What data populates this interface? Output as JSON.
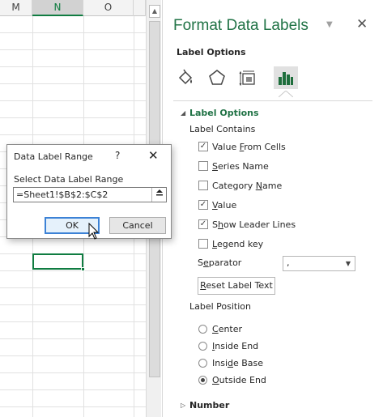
{
  "sheet": {
    "columns": [
      "M",
      "N",
      "O"
    ],
    "selected_column": "N"
  },
  "pane": {
    "title": "Format Data Labels",
    "subtitle": "Label Options",
    "tabs": [
      {
        "icon": "paint-bucket-icon"
      },
      {
        "icon": "pentagon-icon"
      },
      {
        "icon": "size-properties-icon"
      },
      {
        "icon": "bar-chart-icon",
        "active": true
      }
    ],
    "label_options_header": "Label Options",
    "label_contains": "Label Contains",
    "checkboxes": [
      {
        "pre": "Value ",
        "key": "F",
        "post": "rom Cells",
        "checked": true
      },
      {
        "pre": "",
        "key": "S",
        "post": "eries Name",
        "checked": false
      },
      {
        "pre": "Category ",
        "key": "N",
        "post": "ame",
        "checked": false
      },
      {
        "pre": "",
        "key": "V",
        "post": "alue",
        "checked": true
      },
      {
        "pre": "S",
        "key": "h",
        "post": "ow Leader Lines",
        "checked": true
      },
      {
        "pre": "",
        "key": "L",
        "post": "egend key",
        "checked": false
      }
    ],
    "separator": {
      "pre": "S",
      "key": "e",
      "post": "parator",
      "value": ","
    },
    "reset": {
      "pre": "",
      "key": "R",
      "post": "eset Label Text"
    },
    "label_position": "Label Position",
    "radios": [
      {
        "pre": "",
        "key": "C",
        "post": "enter",
        "selected": false
      },
      {
        "pre": "",
        "key": "I",
        "post": "nside End",
        "selected": false
      },
      {
        "pre": "Insi",
        "key": "d",
        "post": "e Base",
        "selected": false
      },
      {
        "pre": "",
        "key": "O",
        "post": "utside End",
        "selected": true
      }
    ],
    "number_header": "Number"
  },
  "dialog": {
    "title": "Data Label Range",
    "help": "?",
    "close": "✕",
    "prompt": "Select Data Label Range",
    "value": "=Sheet1!$B$2:$C$2",
    "ok": "OK",
    "cancel": "Cancel"
  },
  "colors": {
    "accent": "#217346",
    "selection": "#107c41",
    "chart_icon": "#1e6e3c",
    "focus_border": "#3c82d6"
  }
}
